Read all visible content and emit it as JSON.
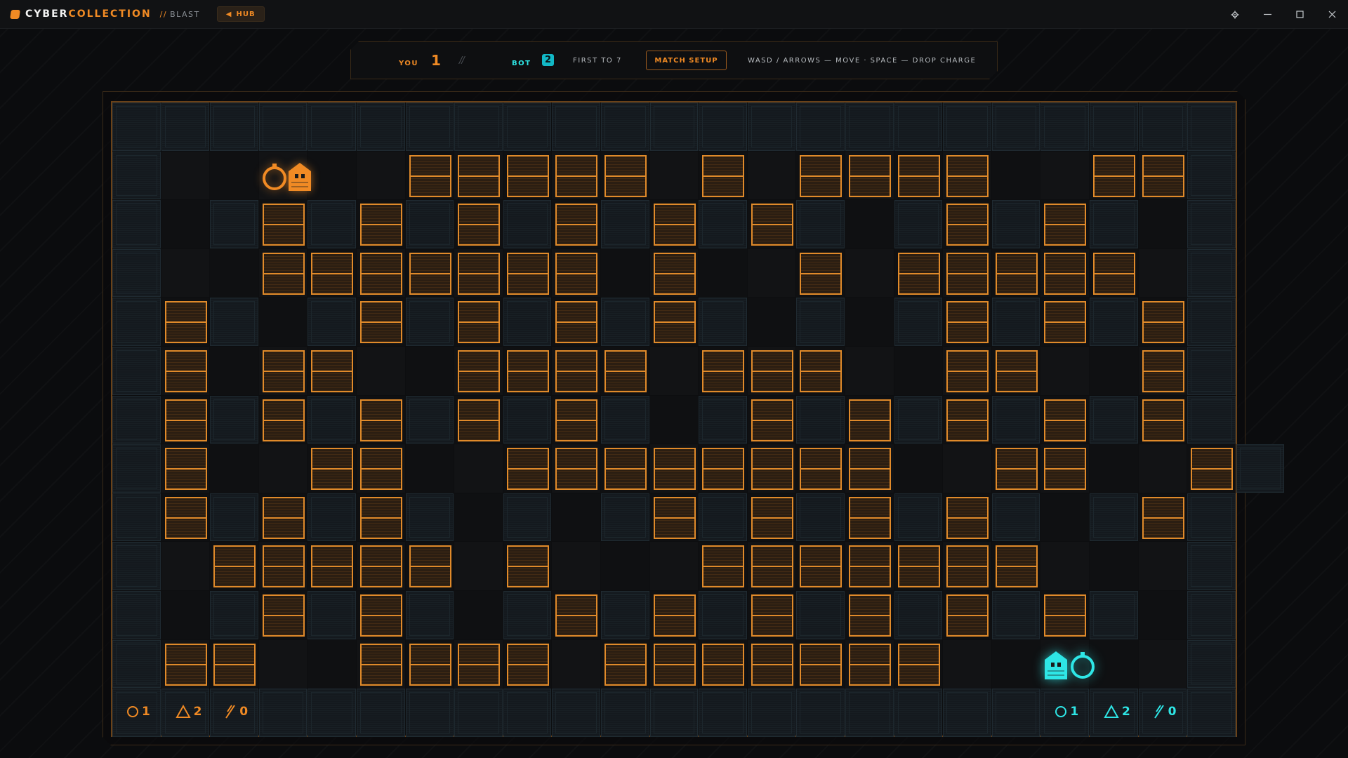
{
  "app": {
    "brand_primary": "CYBER",
    "brand_accent": "COLLECTION",
    "crumb_sep": "//",
    "crumb": "BLAST",
    "hub_label": "HUB"
  },
  "window_controls": [
    "gear-icon",
    "minimize-icon",
    "maximize-icon",
    "close-icon"
  ],
  "scoreboard": {
    "you_label": "YOU",
    "you_score": "1",
    "separator": "//",
    "bot_label": "BOT",
    "bot_score": "2",
    "first_to": "FIRST TO 7",
    "setup_label": "MATCH SETUP",
    "help": "WASD / ARROWS — MOVE · SPACE — DROP CHARGE"
  },
  "colors": {
    "accent_orange": "#f08a24",
    "accent_cyan": "#2ee6e6",
    "wall": "#14191e",
    "crate_border": "#e08a2a"
  },
  "board": {
    "cols": 23,
    "rows": 13,
    "legend": "# = wall, C = crate, . = floor",
    "grid": [
      "#######################",
      "#.....CCCCC.C.CCCC..CC#",
      "#.#C#C#C#C#C#C#.#C#C#.#",
      "#..CCCCCCC.C..C.CCCCC.#",
      "#C#.#C#C#C#C#.#.#C#C#C#",
      "#C.CC..CCCC.CCC..CC..C#",
      "#C#C#C#C#C#.#C#C#C#C#C#",
      "#C..CC..CCCCCCCC..CC..C#",
      "#C#C#C#.#.#C#C#C#C#.#C#",
      "#.CCCCC.C...CCCCCCC...#",
      "#.#C#C#.#C#C#C#C#C#C#.#",
      "#CC..CCCC.CCCCCCC.....#",
      "#######################"
    ]
  },
  "players": {
    "you": {
      "name": "player-orange",
      "col": 3,
      "row": 1,
      "color": "#f08a24"
    },
    "bot": {
      "name": "player-cyan",
      "col": 19,
      "row": 11,
      "color": "#2ee6e6"
    }
  },
  "stats": {
    "you": {
      "bombs": "1",
      "range": "2",
      "speed": "0"
    },
    "bot": {
      "bombs": "1",
      "range": "2",
      "speed": "0"
    }
  }
}
